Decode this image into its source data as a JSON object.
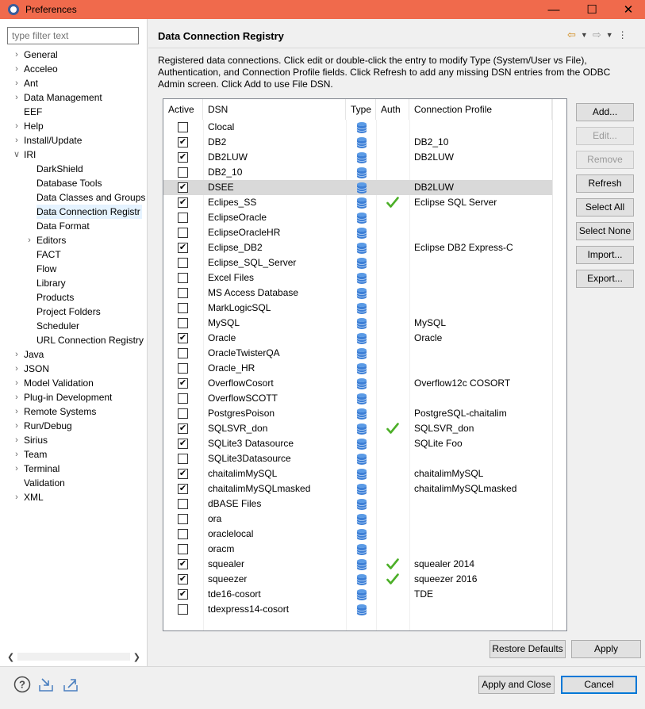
{
  "window": {
    "title": "Preferences"
  },
  "filter": {
    "placeholder": "type filter text"
  },
  "tree": [
    {
      "label": "General",
      "level": 0,
      "expander": "collapsed"
    },
    {
      "label": "Acceleo",
      "level": 0,
      "expander": "collapsed"
    },
    {
      "label": "Ant",
      "level": 0,
      "expander": "collapsed"
    },
    {
      "label": "Data Management",
      "level": 0,
      "expander": "collapsed"
    },
    {
      "label": "EEF",
      "level": 0,
      "expander": "none"
    },
    {
      "label": "Help",
      "level": 0,
      "expander": "collapsed"
    },
    {
      "label": "Install/Update",
      "level": 0,
      "expander": "collapsed"
    },
    {
      "label": "IRI",
      "level": 0,
      "expander": "expanded"
    },
    {
      "label": "DarkShield",
      "level": 1,
      "expander": "none"
    },
    {
      "label": "Database Tools",
      "level": 1,
      "expander": "none"
    },
    {
      "label": "Data Classes and Groups",
      "level": 1,
      "expander": "none"
    },
    {
      "label": "Data Connection Registr",
      "level": 1,
      "expander": "none",
      "selected": true
    },
    {
      "label": "Data Format",
      "level": 1,
      "expander": "none"
    },
    {
      "label": "Editors",
      "level": 1,
      "expander": "collapsed"
    },
    {
      "label": "FACT",
      "level": 1,
      "expander": "none"
    },
    {
      "label": "Flow",
      "level": 1,
      "expander": "none"
    },
    {
      "label": "Library",
      "level": 1,
      "expander": "none"
    },
    {
      "label": "Products",
      "level": 1,
      "expander": "none"
    },
    {
      "label": "Project Folders",
      "level": 1,
      "expander": "none"
    },
    {
      "label": "Scheduler",
      "level": 1,
      "expander": "none"
    },
    {
      "label": "URL Connection Registry",
      "level": 1,
      "expander": "none"
    },
    {
      "label": "Java",
      "level": 0,
      "expander": "collapsed"
    },
    {
      "label": "JSON",
      "level": 0,
      "expander": "collapsed"
    },
    {
      "label": "Model Validation",
      "level": 0,
      "expander": "collapsed"
    },
    {
      "label": "Plug-in Development",
      "level": 0,
      "expander": "collapsed"
    },
    {
      "label": "Remote Systems",
      "level": 0,
      "expander": "collapsed"
    },
    {
      "label": "Run/Debug",
      "level": 0,
      "expander": "collapsed"
    },
    {
      "label": "Sirius",
      "level": 0,
      "expander": "collapsed"
    },
    {
      "label": "Team",
      "level": 0,
      "expander": "collapsed"
    },
    {
      "label": "Terminal",
      "level": 0,
      "expander": "collapsed"
    },
    {
      "label": "Validation",
      "level": 0,
      "expander": "none"
    },
    {
      "label": "XML",
      "level": 0,
      "expander": "collapsed"
    }
  ],
  "page": {
    "title": "Data Connection Registry",
    "description": "Registered data connections. Click edit or double-click the entry to modify Type (System/User vs File), Authentication, and Connection Profile fields. Click Refresh to add any missing DSN entries from the ODBC Admin screen. Click Add to use File DSN."
  },
  "table": {
    "columns": [
      "Active",
      "DSN",
      "Type",
      "Auth",
      "Connection Profile"
    ],
    "rows": [
      {
        "active": false,
        "dsn": "Clocal",
        "auth": false,
        "profile": ""
      },
      {
        "active": true,
        "dsn": "DB2",
        "auth": false,
        "profile": "DB2_10"
      },
      {
        "active": true,
        "dsn": "DB2LUW",
        "auth": false,
        "profile": "DB2LUW"
      },
      {
        "active": false,
        "dsn": "DB2_10",
        "auth": false,
        "profile": ""
      },
      {
        "active": true,
        "dsn": "DSEE",
        "auth": false,
        "profile": "DB2LUW",
        "selected": true
      },
      {
        "active": true,
        "dsn": "Eclipes_SS",
        "auth": true,
        "profile": "Eclipse SQL Server"
      },
      {
        "active": false,
        "dsn": "EclipseOracle",
        "auth": false,
        "profile": ""
      },
      {
        "active": false,
        "dsn": "EclipseOracleHR",
        "auth": false,
        "profile": ""
      },
      {
        "active": true,
        "dsn": "Eclipse_DB2",
        "auth": false,
        "profile": "Eclipse DB2 Express-C"
      },
      {
        "active": false,
        "dsn": "Eclipse_SQL_Server",
        "auth": false,
        "profile": ""
      },
      {
        "active": false,
        "dsn": "Excel Files",
        "auth": false,
        "profile": ""
      },
      {
        "active": false,
        "dsn": "MS Access Database",
        "auth": false,
        "profile": ""
      },
      {
        "active": false,
        "dsn": "MarkLogicSQL",
        "auth": false,
        "profile": ""
      },
      {
        "active": false,
        "dsn": "MySQL",
        "auth": false,
        "profile": "MySQL"
      },
      {
        "active": true,
        "dsn": "Oracle",
        "auth": false,
        "profile": "Oracle"
      },
      {
        "active": false,
        "dsn": "OracleTwisterQA",
        "auth": false,
        "profile": ""
      },
      {
        "active": false,
        "dsn": "Oracle_HR",
        "auth": false,
        "profile": ""
      },
      {
        "active": true,
        "dsn": "OverflowCosort",
        "auth": false,
        "profile": "Overflow12c COSORT"
      },
      {
        "active": false,
        "dsn": "OverflowSCOTT",
        "auth": false,
        "profile": ""
      },
      {
        "active": false,
        "dsn": "PostgresPoison",
        "auth": false,
        "profile": "PostgreSQL-chaitalim"
      },
      {
        "active": true,
        "dsn": "SQLSVR_don",
        "auth": true,
        "profile": "SQLSVR_don"
      },
      {
        "active": true,
        "dsn": "SQLite3 Datasource",
        "auth": false,
        "profile": "SQLite Foo"
      },
      {
        "active": false,
        "dsn": "SQLite3Datasource",
        "auth": false,
        "profile": ""
      },
      {
        "active": true,
        "dsn": "chaitalimMySQL",
        "auth": false,
        "profile": "chaitalimMySQL"
      },
      {
        "active": true,
        "dsn": "chaitalimMySQLmasked",
        "auth": false,
        "profile": "chaitalimMySQLmasked"
      },
      {
        "active": false,
        "dsn": "dBASE Files",
        "auth": false,
        "profile": ""
      },
      {
        "active": false,
        "dsn": "ora",
        "auth": false,
        "profile": ""
      },
      {
        "active": false,
        "dsn": "oraclelocal",
        "auth": false,
        "profile": ""
      },
      {
        "active": false,
        "dsn": "oracm",
        "auth": false,
        "profile": ""
      },
      {
        "active": true,
        "dsn": "squealer",
        "auth": true,
        "profile": "squealer 2014"
      },
      {
        "active": true,
        "dsn": "squeezer",
        "auth": true,
        "profile": "squeezer 2016"
      },
      {
        "active": true,
        "dsn": "tde16-cosort",
        "auth": false,
        "profile": "TDE"
      },
      {
        "active": false,
        "dsn": "tdexpress14-cosort",
        "auth": false,
        "profile": ""
      }
    ]
  },
  "side_buttons": [
    {
      "label": "Add...",
      "enabled": true
    },
    {
      "label": "Edit...",
      "enabled": false
    },
    {
      "label": "Remove",
      "enabled": false
    },
    {
      "label": "Refresh",
      "enabled": true
    },
    {
      "label": "Select All",
      "enabled": true
    },
    {
      "label": "Select None",
      "enabled": true
    },
    {
      "label": "Import...",
      "enabled": true
    },
    {
      "label": "Export...",
      "enabled": true
    }
  ],
  "buttons": {
    "restore_defaults": "Restore Defaults",
    "apply": "Apply",
    "apply_close": "Apply and Close",
    "cancel": "Cancel"
  },
  "colors": {
    "titlebar": "#f06a4c",
    "db_icon": "#3d7fd6",
    "auth_check": "#4caf28",
    "selection": "#d9d9d9"
  }
}
